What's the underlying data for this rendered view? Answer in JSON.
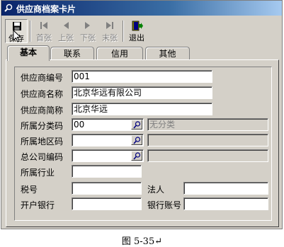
{
  "window": {
    "title": "供应商档案卡片",
    "title_icon": "search-card-icon"
  },
  "toolbar": {
    "buttons": [
      {
        "label": "保存",
        "icon": "save-icon",
        "state": "pressed"
      },
      {
        "label": "首张",
        "icon": "first-icon",
        "state": "disabled"
      },
      {
        "label": "上张",
        "icon": "prev-icon",
        "state": "disabled"
      },
      {
        "label": "下张",
        "icon": "next-icon",
        "state": "disabled"
      },
      {
        "label": "末张",
        "icon": "last-icon",
        "state": "disabled"
      },
      {
        "label": "退出",
        "icon": "exit-icon",
        "state": "enabled"
      }
    ]
  },
  "tabs": [
    {
      "label": "基本",
      "active": true
    },
    {
      "label": "联系",
      "active": false
    },
    {
      "label": "信用",
      "active": false
    },
    {
      "label": "其他",
      "active": false
    }
  ],
  "form": {
    "supplier_code": {
      "label": "供应商编号",
      "value": "001"
    },
    "supplier_name": {
      "label": "供应商名称",
      "value": "北京华远有限公司"
    },
    "supplier_short": {
      "label": "供应商简称",
      "value": "北京华远"
    },
    "category_code": {
      "label": "所属分类码",
      "value": "00",
      "desc": "无分类"
    },
    "region_code": {
      "label": "所属地区码",
      "value": "",
      "desc": ""
    },
    "head_office_code": {
      "label": "总公司编码",
      "value": "",
      "desc": ""
    },
    "industry": {
      "label": "所属行业",
      "value": ""
    },
    "tax_no": {
      "label": "税号",
      "value": ""
    },
    "legal_person": {
      "label": "法人",
      "value": ""
    },
    "bank": {
      "label": "开户银行",
      "value": ""
    },
    "bank_account": {
      "label": "银行账号",
      "value": ""
    }
  },
  "caption": "图 5-35↵"
}
